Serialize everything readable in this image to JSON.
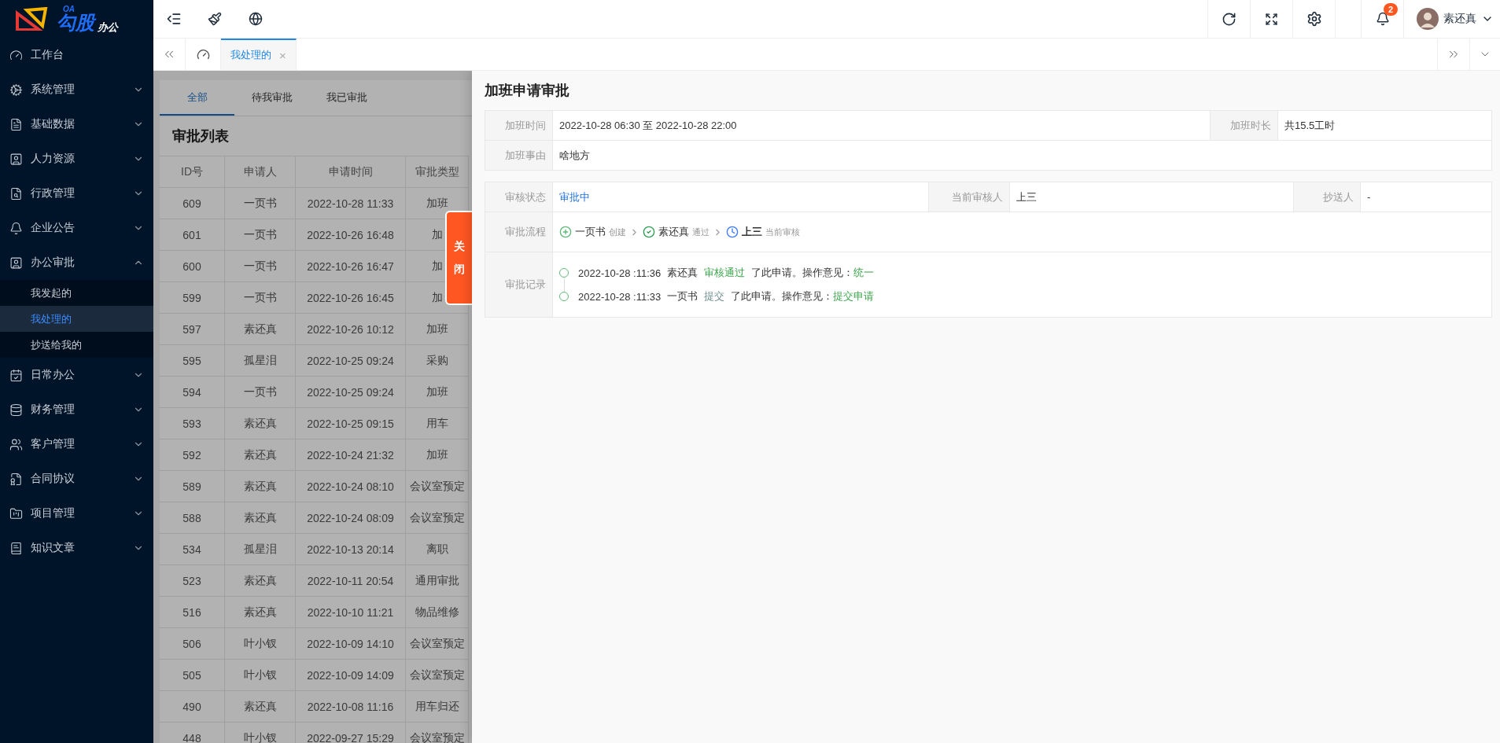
{
  "logo": {
    "top": "OA",
    "main": "勾股",
    "sub": "办公"
  },
  "sidebar": {
    "items": [
      {
        "label": "工作台",
        "selected": false
      },
      {
        "label": "系统管理",
        "selected": false,
        "expanded": false
      },
      {
        "label": "基础数据",
        "selected": false,
        "expanded": false
      },
      {
        "label": "人力资源",
        "selected": false,
        "expanded": false
      },
      {
        "label": "行政管理",
        "selected": false,
        "expanded": false
      },
      {
        "label": "企业公告",
        "selected": false,
        "expanded": false
      },
      {
        "label": "办公审批",
        "selected": false,
        "expanded": true,
        "children": [
          {
            "label": "我发起的",
            "selected": false
          },
          {
            "label": "我处理的",
            "selected": true
          },
          {
            "label": "抄送给我的",
            "selected": false
          }
        ]
      },
      {
        "label": "日常办公",
        "selected": false,
        "expanded": false
      },
      {
        "label": "财务管理",
        "selected": false,
        "expanded": false
      },
      {
        "label": "客户管理",
        "selected": false,
        "expanded": false
      },
      {
        "label": "合同协议",
        "selected": false,
        "expanded": false
      },
      {
        "label": "项目管理",
        "selected": false,
        "expanded": false
      },
      {
        "label": "知识文章",
        "selected": false,
        "expanded": false
      }
    ]
  },
  "header": {
    "badge": "2",
    "user": "素还真"
  },
  "page_tabs": [
    {
      "label": "我处理的",
      "selected": true,
      "close": "×"
    }
  ],
  "list": {
    "filter_tabs": [
      {
        "label": "全部",
        "selected": true
      },
      {
        "label": "待我审批",
        "selected": false
      },
      {
        "label": "我已审批",
        "selected": false
      }
    ],
    "title": "审批列表",
    "columns": [
      "ID号",
      "申请人",
      "申请时间",
      "审批类型"
    ],
    "rows": [
      [
        "609",
        "一页书",
        "2022-10-28 11:33",
        "加班"
      ],
      [
        "601",
        "一页书",
        "2022-10-26 16:48",
        "加"
      ],
      [
        "600",
        "一页书",
        "2022-10-26 16:47",
        "加"
      ],
      [
        "599",
        "一页书",
        "2022-10-26 16:45",
        "加"
      ],
      [
        "597",
        "素还真",
        "2022-10-26 10:12",
        "加班"
      ],
      [
        "595",
        "孤星泪",
        "2022-10-25 09:24",
        "采购"
      ],
      [
        "594",
        "一页书",
        "2022-10-25 09:24",
        "加班"
      ],
      [
        "593",
        "素还真",
        "2022-10-25 09:15",
        "用车"
      ],
      [
        "592",
        "素还真",
        "2022-10-24 21:32",
        "加班"
      ],
      [
        "589",
        "素还真",
        "2022-10-24 08:10",
        "会议室预定"
      ],
      [
        "588",
        "素还真",
        "2022-10-24 08:09",
        "会议室预定"
      ],
      [
        "534",
        "孤星泪",
        "2022-10-13 20:14",
        "离职"
      ],
      [
        "523",
        "素还真",
        "2022-10-11 20:54",
        "通用审批"
      ],
      [
        "516",
        "素还真",
        "2022-10-10 11:21",
        "物品维修"
      ],
      [
        "506",
        "叶小钗",
        "2022-10-09 14:10",
        "会议室预定"
      ],
      [
        "505",
        "叶小钗",
        "2022-10-09 14:09",
        "会议室预定"
      ],
      [
        "490",
        "素还真",
        "2022-10-08 11:16",
        "用车归还"
      ],
      [
        "448",
        "叶小钗",
        "2022-09-27 15:29",
        "会议室预定"
      ]
    ]
  },
  "drawer": {
    "close": "关闭",
    "title": "加班申请审批",
    "details": [
      [
        {
          "label": "加班时间",
          "value": "2022-10-28 06:30 至 2022-10-28 22:00"
        },
        {
          "label": "加班时长",
          "value": "共15.5工时"
        }
      ],
      [
        {
          "label": "加班事由",
          "value": "啥地方"
        }
      ]
    ],
    "status": {
      "label": "审核状态",
      "value": "审批中"
    },
    "reviewer": {
      "label": "当前审核人",
      "value": "上三"
    },
    "cc": {
      "label": "抄送人",
      "value": "-"
    },
    "flow": {
      "label": "审批流程",
      "steps": [
        {
          "kind": "created",
          "name": "一页书",
          "action": "创建"
        },
        {
          "kind": "passed",
          "name": "素还真",
          "action": "通过"
        },
        {
          "kind": "current",
          "name": "上三",
          "action": "当前审核"
        }
      ]
    },
    "records": {
      "label": "审批记录",
      "items": [
        {
          "kind": "pass",
          "time": "2022-10-28 :11:36",
          "name": "素还真",
          "action": "审核通过",
          "text": "了此申请。操作意见：",
          "opinion": "统一"
        },
        {
          "kind": "submit",
          "time": "2022-10-28 :11:33",
          "name": "一页书",
          "action": "提交",
          "text": "了此申请。操作意见：",
          "opinion": "提交申请"
        }
      ]
    }
  }
}
